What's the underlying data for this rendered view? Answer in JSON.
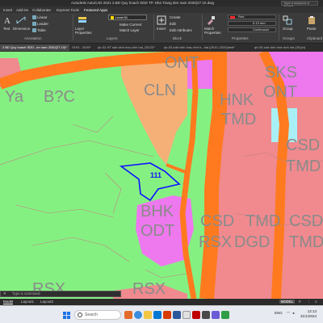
{
  "app": {
    "title": "Autodesk AutoCAD 2021   2.BD Quy hoach SDD TP. Nha Trang den nam 2030(27.10.dwg",
    "search_placeholder": "Type a keyword or phrase"
  },
  "menu": {
    "items": [
      "Insert",
      "Add-ins",
      "Collaborate",
      "Express Tools",
      "Featured Apps"
    ]
  },
  "ribbon": {
    "draw": {
      "text": "Text",
      "dimension": "Dimension"
    },
    "annotation": {
      "linear": "Linear",
      "leader": "Leader",
      "table": "Table",
      "label": "Annotation"
    },
    "layers": {
      "layer_properties": "Layer Properties",
      "current_layer": "Level 51",
      "make_current": "Make Current",
      "match_layer": "Match Layer",
      "label": "Layers"
    },
    "block": {
      "insert": "Insert",
      "create": "Create",
      "edit": "Edit",
      "edit_attributes": "Edit Attributes",
      "label": "Block"
    },
    "properties": {
      "match": "Match Properties",
      "color": "Red",
      "lineweight": "0.13 mm",
      "linetype": "Continuous",
      "label": "Properties"
    },
    "groups": {
      "group": "Group",
      "label": "Groups"
    },
    "clipboard": {
      "paste": "Paste",
      "label": "Clipboard"
    },
    "accent_red": "#ff2a2a"
  },
  "file_tabs": [
    "2.BD Quy hoach SDD...en nam 2030(27.10)*",
    "GHI3 - 2030*",
    "qh-02-HT sdd vinh hoa-vinh hai_23122*",
    "qh-03-sdd vinh hoa-vinh h...hai (28.01.2024)land*",
    "qh-03-sdd vinh hoa vinh hai (25.pd)"
  ],
  "drawing": {
    "parcel_number": "111",
    "labels": [
      "ONT",
      "CLN",
      "SKS",
      "ONT",
      "HNK",
      "TMD",
      "CSD",
      "TMD",
      "BHK",
      "ODT",
      "CSD",
      "TMD",
      "CSD",
      "DGD",
      "TMD",
      "RSX",
      "RSX",
      "RSX",
      "B?C",
      "Ya"
    ],
    "colors": {
      "green": "#85f082",
      "pink": "#f08a8f",
      "magenta": "#ee78ee",
      "orange": "#ff7a1f",
      "tan": "#f5b077",
      "cyan": "#a8f0f5",
      "label_gray": "#8a8a8a",
      "parcel_outline": "#1010ff"
    }
  },
  "command_line": {
    "placeholder": "Type a command"
  },
  "status_tabs": [
    "Model",
    "Layout1",
    "Layout2"
  ],
  "status": {
    "model": "MODEL"
  },
  "taskbar": {
    "search": "Search",
    "tray": "ENG",
    "time": "12:13",
    "date": "31/1/2024"
  }
}
